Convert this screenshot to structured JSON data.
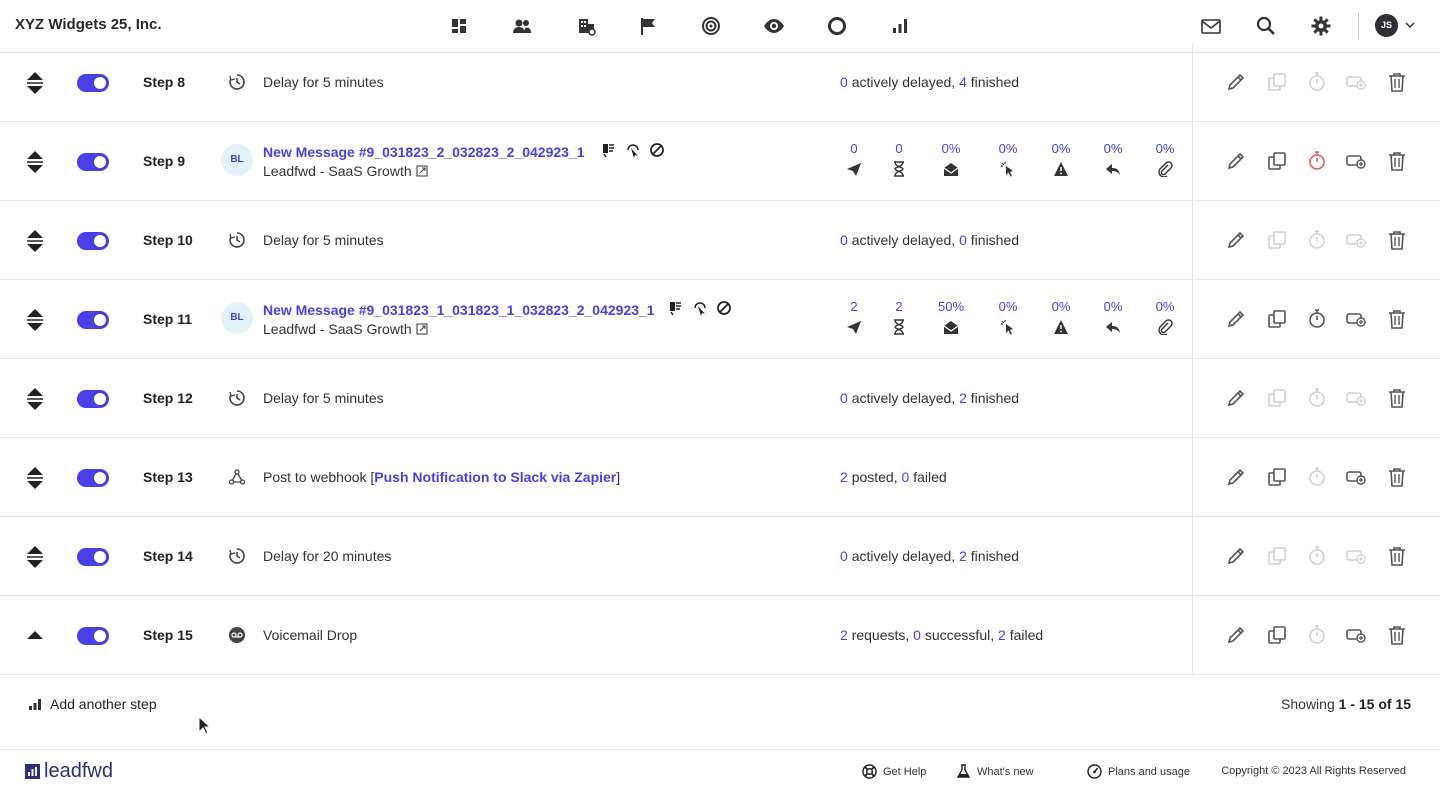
{
  "header": {
    "brand": "XYZ Widgets 25, Inc.",
    "nav_icons": [
      "dashboard-icon",
      "contacts-icon",
      "companies-icon",
      "campaigns-icon",
      "goals-icon",
      "visitors-icon",
      "circle-icon",
      "reports-icon"
    ],
    "right_icons": [
      "mail-icon",
      "search-icon",
      "gear-icon"
    ],
    "avatar_initials": "JS"
  },
  "colors": {
    "accent": "#4a3fe6",
    "badge_bg": "#e3f1fb",
    "disabled": "#cfcfd6",
    "timer_red": "#e85a5a"
  },
  "steps": [
    {
      "label": "Step 8",
      "kind": "delay",
      "desc": "Delay for 5 minutes",
      "stats": {
        "a": "0",
        "a_text": "actively delayed,",
        "b": "4",
        "b_text": "finished"
      }
    },
    {
      "label": "Step 9",
      "kind": "message",
      "badge": "BL",
      "title": "New Message #9_031823_2_032823_2_042923_1",
      "sub": "Leadfwd - SaaS Growth",
      "metrics": [
        "0",
        "0",
        "0%",
        "0%",
        "0%",
        "0%",
        "0%"
      ]
    },
    {
      "label": "Step 10",
      "kind": "delay",
      "desc": "Delay for 5 minutes",
      "stats": {
        "a": "0",
        "a_text": "actively delayed,",
        "b": "0",
        "b_text": "finished"
      }
    },
    {
      "label": "Step 11",
      "kind": "message",
      "badge": "BL",
      "title": "New Message #9_031823_1_031823_1_032823_2_042923_1",
      "sub": "Leadfwd - SaaS Growth",
      "metrics": [
        "2",
        "2",
        "50%",
        "0%",
        "0%",
        "0%",
        "0%"
      ]
    },
    {
      "label": "Step 12",
      "kind": "delay",
      "desc": "Delay for 5 minutes",
      "stats": {
        "a": "0",
        "a_text": "actively delayed,",
        "b": "2",
        "b_text": "finished"
      }
    },
    {
      "label": "Step 13",
      "kind": "webhook",
      "desc_prefix": "Post to webhook [",
      "desc_link": "Push Notification to Slack via Zapier",
      "desc_suffix": "]",
      "stats": {
        "a": "2",
        "a_text": "posted,",
        "b": "0",
        "b_text": "failed"
      }
    },
    {
      "label": "Step 14",
      "kind": "delay",
      "desc": "Delay for 20 minutes",
      "stats": {
        "a": "0",
        "a_text": "actively delayed,",
        "b": "2",
        "b_text": "finished"
      }
    },
    {
      "label": "Step 15",
      "kind": "voicemail",
      "desc": "Voicemail Drop",
      "stats3": {
        "a": "2",
        "a_text": "requests,",
        "b": "0",
        "b_text": "successful,",
        "c": "2",
        "c_text": "failed"
      }
    }
  ],
  "add_step_label": "Add another step",
  "showing": {
    "prefix": "Showing",
    "range": "1 - 15 of 15"
  },
  "footer": {
    "logo_text": "leadfwd",
    "links": [
      {
        "label": "Get Help",
        "icon": "lifebuoy-icon"
      },
      {
        "label": "What's new",
        "icon": "flask-icon"
      },
      {
        "label": "Plans and usage",
        "icon": "gauge-icon"
      }
    ],
    "copyright": "Copyright © 2023 All Rights Reserved"
  }
}
